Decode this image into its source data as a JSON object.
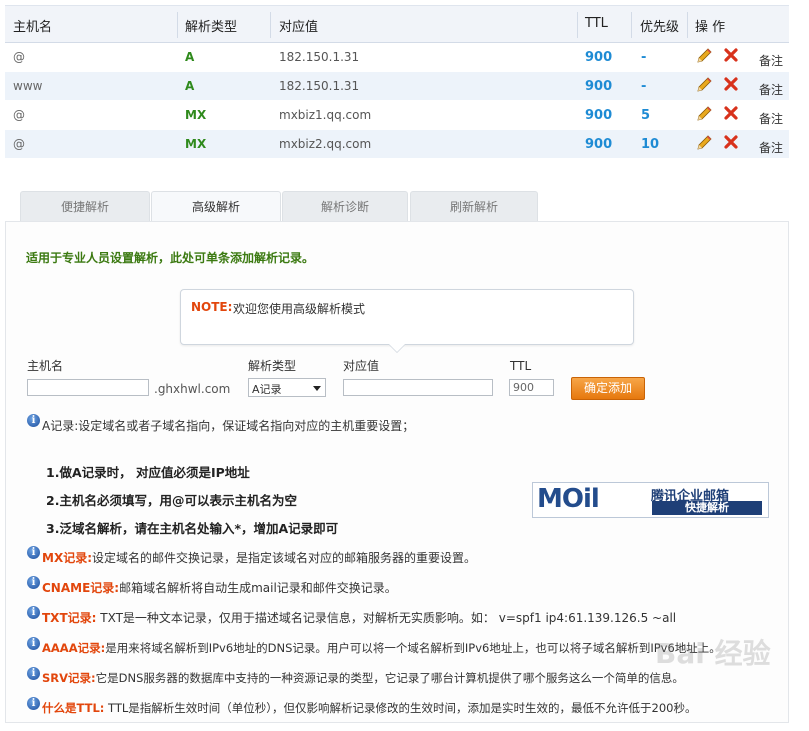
{
  "table": {
    "headers": {
      "host": "主机名",
      "type": "解析类型",
      "value": "对应值",
      "ttl": "TTL",
      "priority": "优先级",
      "ops": "操 作"
    },
    "rows": [
      {
        "host": "@",
        "type": "A",
        "value": "182.150.1.31",
        "ttl": "900",
        "priority": "-",
        "note": "备注"
      },
      {
        "host": "www",
        "type": "A",
        "value": "182.150.1.31",
        "ttl": "900",
        "priority": "-",
        "note": "备注"
      },
      {
        "host": "@",
        "type": "MX",
        "value": "mxbiz1.qq.com",
        "ttl": "900",
        "priority": "5",
        "note": "备注"
      },
      {
        "host": "@",
        "type": "MX",
        "value": "mxbiz2.qq.com",
        "ttl": "900",
        "priority": "10",
        "note": "备注"
      }
    ]
  },
  "tabs": [
    {
      "label": "便捷解析"
    },
    {
      "label": "高级解析"
    },
    {
      "label": "解析诊断"
    },
    {
      "label": "刷新解析"
    }
  ],
  "panel": {
    "intro": "适用于专业人员设置解析，此处可单条添加解析记录。",
    "note_title": "NOTE:",
    "note_text": "欢迎您使用高级解析模式"
  },
  "form": {
    "host_label": "主机名",
    "host_value": "",
    "domain_suffix": ".ghxhwl.com",
    "type_label": "解析类型",
    "type_selected": "A记录",
    "value_label": "对应值",
    "value_value": "",
    "ttl_label": "TTL",
    "ttl_value": "900",
    "submit_label": "确定添加"
  },
  "info": {
    "a_record": "A记录:设定域名或者子域名指向，保证域名指向对应的主机重要设置；",
    "steps": [
      "1.做A记录时， 对应值必须是IP地址",
      "2.主机名必须填写，用@可以表示主机名为空",
      "3.泛域名解析，请在主机名处输入*，增加A记录即可"
    ],
    "mx_label": "MX记录:",
    "mx_text": "设定域名的邮件交换记录，是指定该域名对应的邮箱服务器的重要设置。",
    "cname_label": "CNAME记录:",
    "cname_text": "邮箱域名解析将自动生成mail记录和邮件交换记录。",
    "txt_label": "TXT记录:",
    "txt_text": " TXT是一种文本记录，仅用于描述域名记录信息，对解析无实质影响。如： v=spf1 ip4:61.139.126.5 ~all",
    "aaaa_label": "AAAA记录:",
    "aaaa_text": "是用来将域名解析到IPv6地址的DNS记录。用户可以将一个域名解析到IPv6地址上，也可以将子域名解析到IPv6地址上。",
    "srv_label": "SRV记录:",
    "srv_text": "它是DNS服务器的数据库中支持的一种资源记录的类型，它记录了哪台计算机提供了哪个服务这么一个简单的信息。",
    "ttl_label": "什么是TTL:",
    "ttl_text": " TTL是指解析生效时间（单位秒），但仅影响解析记录修改的生效时间，添加是实时生效的，最低不允许低于200秒。"
  },
  "banner": {
    "logo": "MOil",
    "title": "腾讯企业邮箱",
    "subtitle": "快捷解析"
  },
  "watermark": "Bai 经验",
  "colors": {
    "accent_green": "#2f8a1c",
    "accent_blue": "#1e8bd4",
    "accent_red": "#e2460c",
    "button_orange": "#f08a1d"
  }
}
